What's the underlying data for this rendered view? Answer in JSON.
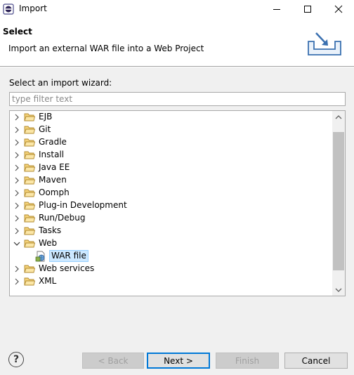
{
  "window": {
    "title": "Import",
    "icon": "eclipse-icon"
  },
  "banner": {
    "title": "Select",
    "description": "Import an external WAR file into a Web Project",
    "graphic": "import-tray-icon"
  },
  "content": {
    "wizard_label": "Select an import wizard:",
    "filter_placeholder": "type filter text",
    "tree": [
      {
        "label": "EJB",
        "expanded": false,
        "level": 0
      },
      {
        "label": "Git",
        "expanded": false,
        "level": 0
      },
      {
        "label": "Gradle",
        "expanded": false,
        "level": 0
      },
      {
        "label": "Install",
        "expanded": false,
        "level": 0
      },
      {
        "label": "Java EE",
        "expanded": false,
        "level": 0
      },
      {
        "label": "Maven",
        "expanded": false,
        "level": 0
      },
      {
        "label": "Oomph",
        "expanded": false,
        "level": 0
      },
      {
        "label": "Plug-in Development",
        "expanded": false,
        "level": 0
      },
      {
        "label": "Run/Debug",
        "expanded": false,
        "level": 0
      },
      {
        "label": "Tasks",
        "expanded": false,
        "level": 0
      },
      {
        "label": "Web",
        "expanded": true,
        "level": 0
      },
      {
        "label": "WAR file",
        "selected": true,
        "level": 1
      },
      {
        "label": "Web services",
        "expanded": false,
        "level": 0
      },
      {
        "label": "XML",
        "expanded": false,
        "level": 0
      }
    ]
  },
  "footer": {
    "help": "?",
    "back_label": "< Back",
    "next_label": "Next >",
    "finish_label": "Finish",
    "cancel_label": "Cancel"
  },
  "colors": {
    "selection_bg": "#cce8ff",
    "default_button_border": "#0078d7",
    "folder_fill": "#f5d37a",
    "dialog_bg": "#f0f0f0"
  }
}
